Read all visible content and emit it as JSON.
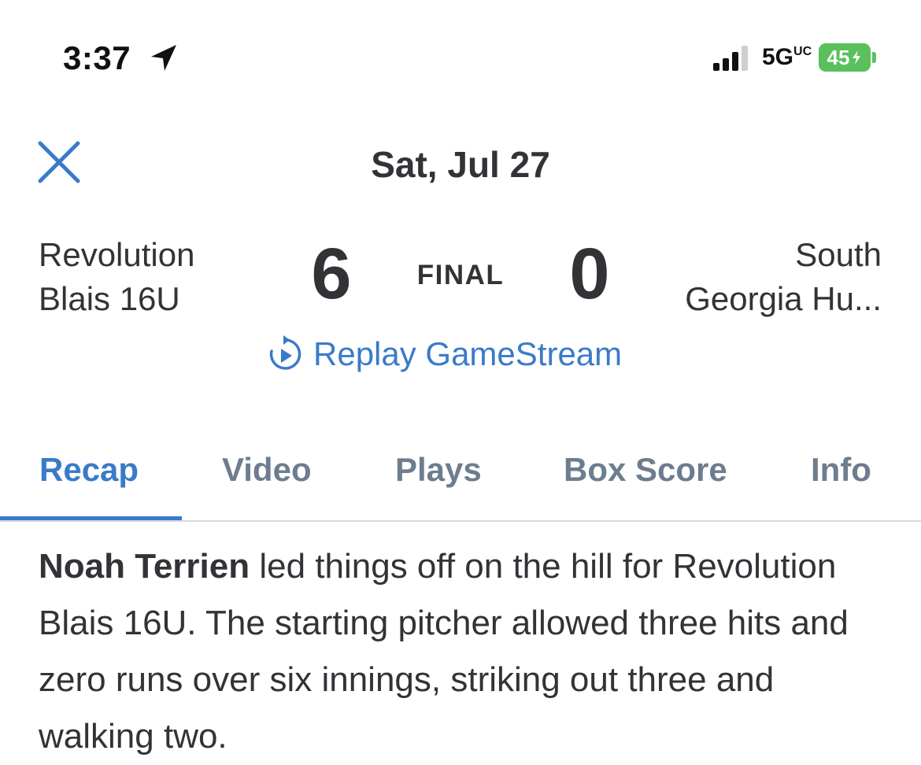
{
  "status_bar": {
    "time": "3:37",
    "network": "5G",
    "network_suffix": "UC",
    "battery": "45",
    "icons": [
      "location-arrow-icon",
      "signal-bars-icon",
      "battery-charging-icon"
    ]
  },
  "header": {
    "date": "Sat, Jul 27",
    "close_icon": "close-icon"
  },
  "game": {
    "home_team": {
      "line1": "Revolution",
      "line2": "Blais 16U",
      "score": "6"
    },
    "away_team": {
      "line1": "South",
      "line2": "Georgia Hu...",
      "score": "0"
    },
    "status": "FINAL",
    "replay_label": "Replay GameStream",
    "replay_icon": "replay-play-icon"
  },
  "tabs": [
    {
      "label": "Recap",
      "active": true
    },
    {
      "label": "Video",
      "active": false
    },
    {
      "label": "Plays",
      "active": false
    },
    {
      "label": "Box Score",
      "active": false
    },
    {
      "label": "Info",
      "active": false
    }
  ],
  "recap": {
    "player": "Noah Terrien",
    "text": " led things off on the hill for Revolution Blais 16U. The starting pitcher allowed three hits and zero runs over six innings, striking out three and walking two."
  },
  "colors": {
    "accent": "#3a7bc8",
    "text": "#323337",
    "tab_inactive": "#6d7d8e",
    "battery": "#5ac05b"
  }
}
